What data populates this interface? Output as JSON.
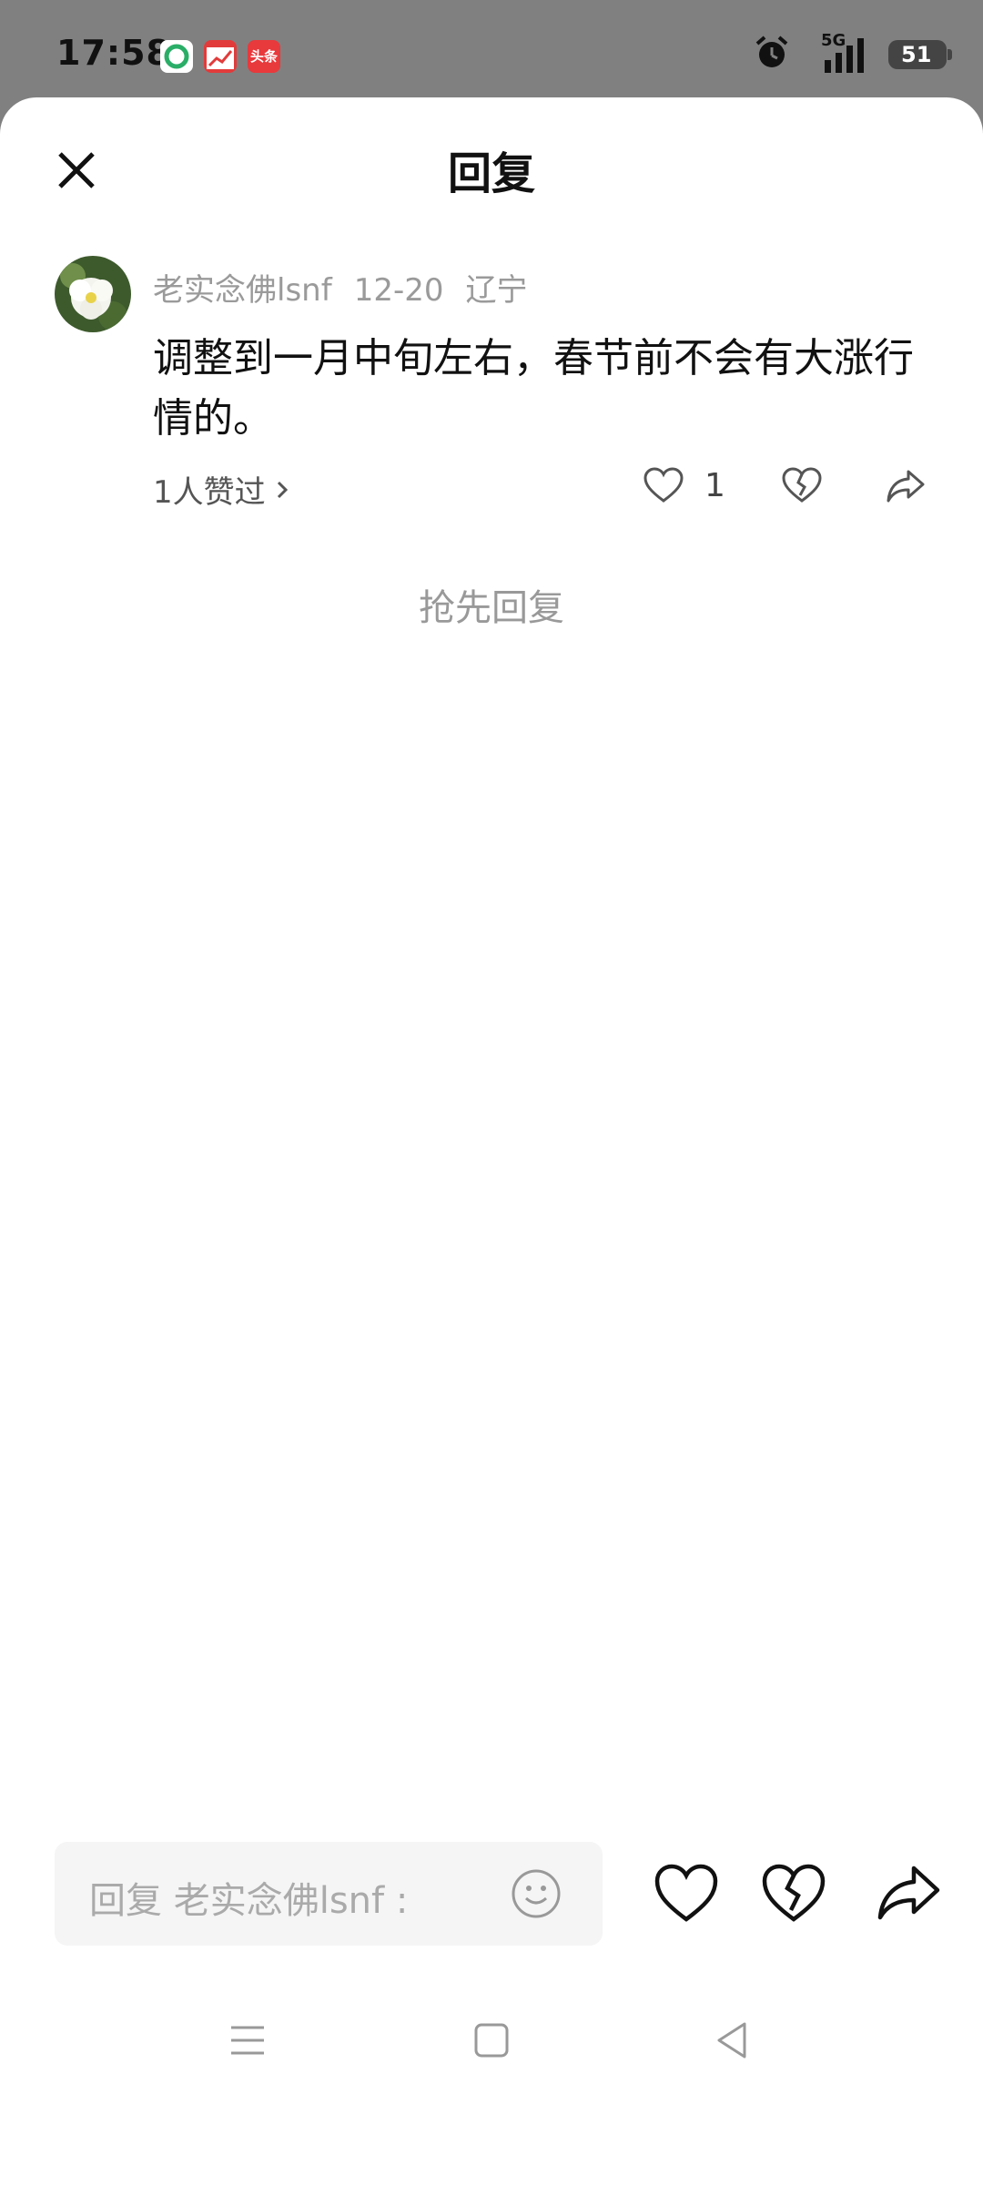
{
  "status_bar": {
    "time": "17:58",
    "notification_icons": [
      "wechat-style-app-icon",
      "stock-app-icon",
      "toutiao-app-icon"
    ],
    "toutiao_label": "头条",
    "alarm_icon": "alarm-clock-icon",
    "network_label": "5G",
    "signal_icon": "signal-bars-icon",
    "battery_level": "51"
  },
  "sheet": {
    "title": "回复",
    "close_icon": "close-icon"
  },
  "comment": {
    "author": "老实念佛lsnf",
    "date": "12-20",
    "location": "辽宁",
    "text": "调整到一月中旬左右，春节前不会有大涨行情的。",
    "likes_link": "1人赞过",
    "like_count": "1"
  },
  "empty_state": {
    "first_reply_label": "抢先回复"
  },
  "reply_bar": {
    "placeholder": "回复 老实念佛lsnf :"
  },
  "colors": {
    "accent_text": "#111111",
    "muted_text": "#9a9a9a",
    "background_dim": "#808080"
  }
}
